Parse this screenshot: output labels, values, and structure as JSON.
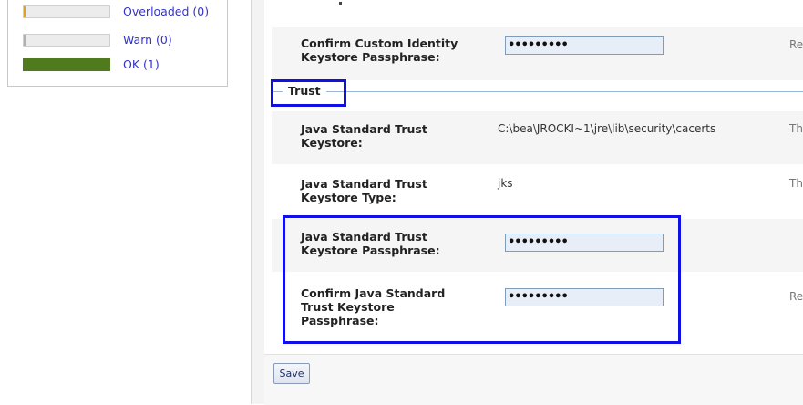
{
  "health_panel": {
    "items": [
      {
        "label": "Overloaded (0)",
        "color": "#e0a020",
        "fill": 0.0
      },
      {
        "label": "Warn (0)",
        "color": "#e6c000",
        "fill": 0.0
      },
      {
        "label": "OK (1)",
        "color": "#4f7a1e",
        "fill": 1.0
      }
    ]
  },
  "form": {
    "confirm_identity_label": "Confirm Custom Identity Keystore Passphrase:",
    "confirm_identity_value": "•••••••••",
    "confirm_identity_desc": "Re-",
    "trust_legend": "Trust",
    "trust_keystore_label": "Java Standard Trust Keystore:",
    "trust_keystore_value": "C:\\bea\\JROCKI~1\\jre\\lib\\security\\cacerts",
    "trust_keystore_desc": "The",
    "trust_type_label": "Java Standard Trust Keystore Type:",
    "trust_type_value": "jks",
    "trust_type_desc": "The",
    "trust_pass_label": "Java Standard Trust Keystore Passphrase:",
    "trust_pass_value": "•••••••••",
    "confirm_trust_label": "Confirm Java Standard Trust Keystore Passphrase:",
    "confirm_trust_value": "•••••••••",
    "confirm_trust_desc": "Re-",
    "save_label": "Save"
  },
  "highlight_color": "#1010e6"
}
